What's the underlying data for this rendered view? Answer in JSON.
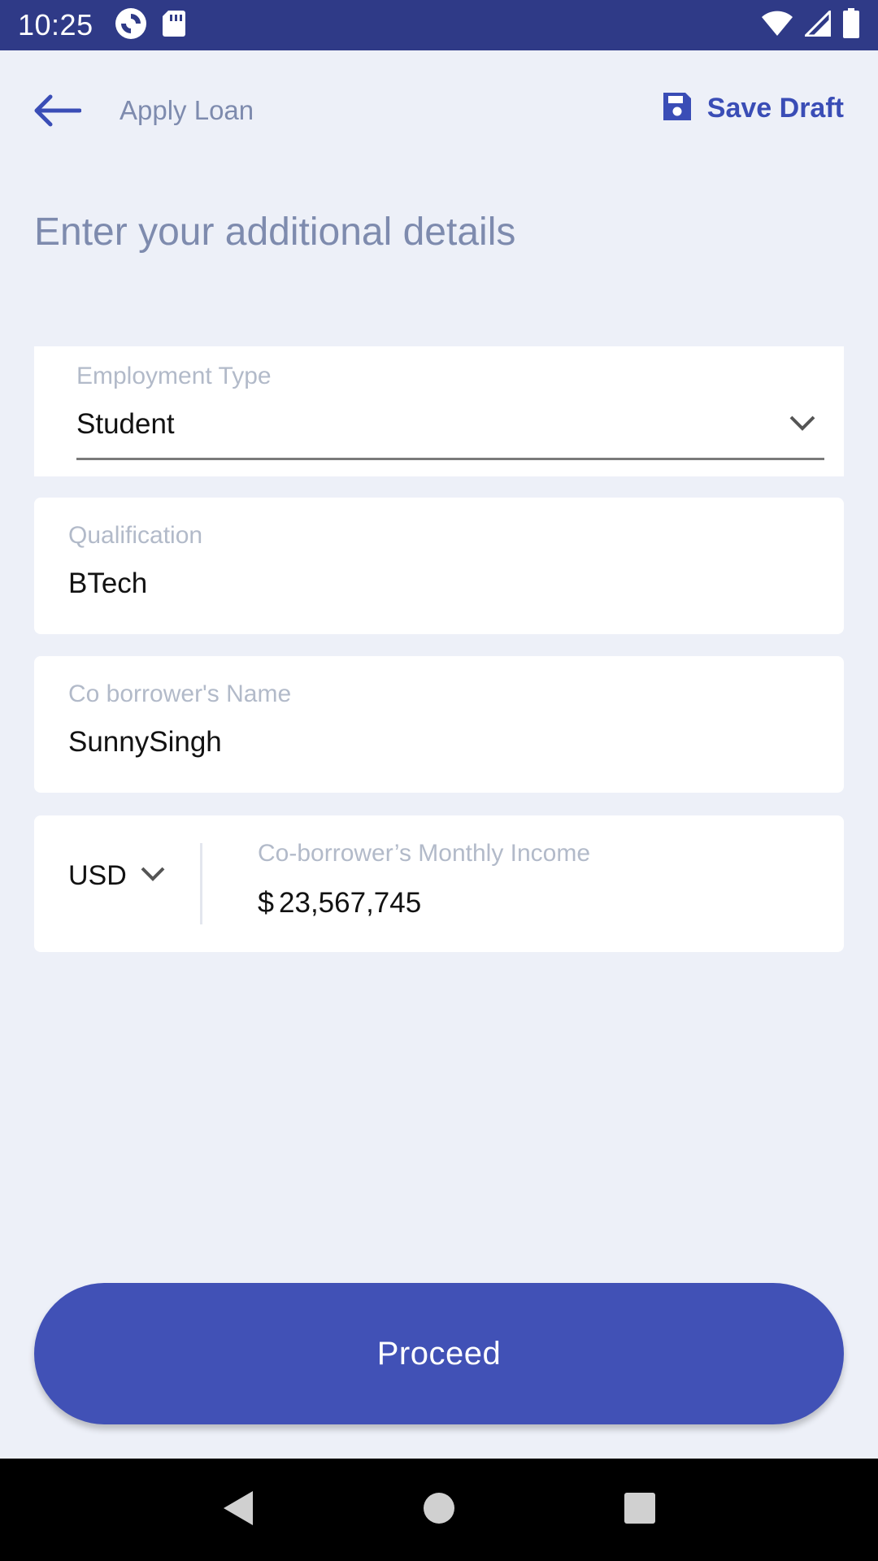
{
  "status_bar": {
    "time": "10:25",
    "icons": [
      "sync-app-icon",
      "sd-card-icon",
      "wifi-icon",
      "signal-icon",
      "battery-icon"
    ]
  },
  "header": {
    "back_icon": "back-arrow-icon",
    "title": "Apply Loan",
    "save_draft_icon": "save-icon",
    "save_draft_label": "Save Draft"
  },
  "heading": "Enter your additional details",
  "form": {
    "employment_type": {
      "label": "Employment Type",
      "value": "Student"
    },
    "qualification": {
      "label": "Qualification",
      "value": "BTech"
    },
    "co_borrower_name": {
      "label": "Co borrower's Name",
      "value": "SunnySingh"
    },
    "co_borrower_income": {
      "currency": "USD",
      "label": "Co-borrower’s Monthly Income",
      "symbol": "$",
      "value": "23,567,745"
    }
  },
  "actions": {
    "proceed_label": "Proceed"
  },
  "nav": {
    "buttons": [
      "back-triangle-icon",
      "home-circle-icon",
      "recents-square-icon"
    ]
  },
  "colors": {
    "status_bar": "#2F3A87",
    "accent": "#3A4DB6",
    "button": "#4151B6",
    "background": "#EDF0F8",
    "muted_text": "#7E8BAE",
    "label_text": "#B2BAC9"
  }
}
